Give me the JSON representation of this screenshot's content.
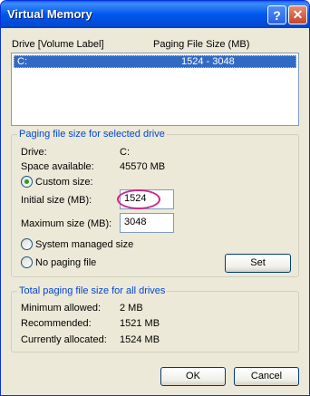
{
  "window": {
    "title": "Virtual Memory"
  },
  "title_buttons": {
    "help": "?",
    "close": "✕"
  },
  "drive_list": {
    "columns": [
      "Drive  [Volume Label]",
      "Paging File Size (MB)"
    ],
    "rows": [
      {
        "drive": "C:",
        "size": "1524 - 3048",
        "selected": true
      }
    ]
  },
  "selected_drive": {
    "group_label": "Paging file size for selected drive",
    "drive_label": "Drive:",
    "drive_value": "C:",
    "space_label": "Space available:",
    "space_value": "45570 MB",
    "custom_size_label": "Custom size:",
    "initial_label": "Initial size (MB):",
    "initial_value": "1524",
    "maximum_label": "Maximum size (MB):",
    "maximum_value": "3048",
    "system_managed_label": "System managed size",
    "no_paging_label": "No paging file",
    "set_label": "Set",
    "selected_option": "custom"
  },
  "all_drives": {
    "group_label": "Total paging file size for all drives",
    "minimum_label": "Minimum allowed:",
    "minimum_value": "2 MB",
    "recommended_label": "Recommended:",
    "recommended_value": "1521 MB",
    "allocated_label": "Currently allocated:",
    "allocated_value": "1524 MB"
  },
  "footer": {
    "ok_label": "OK",
    "cancel_label": "Cancel"
  },
  "colors": {
    "title_bar": "#0058ee",
    "group_label": "#0046d5",
    "selection": "#316ac5",
    "highlight_ellipse": "#d0288a"
  }
}
